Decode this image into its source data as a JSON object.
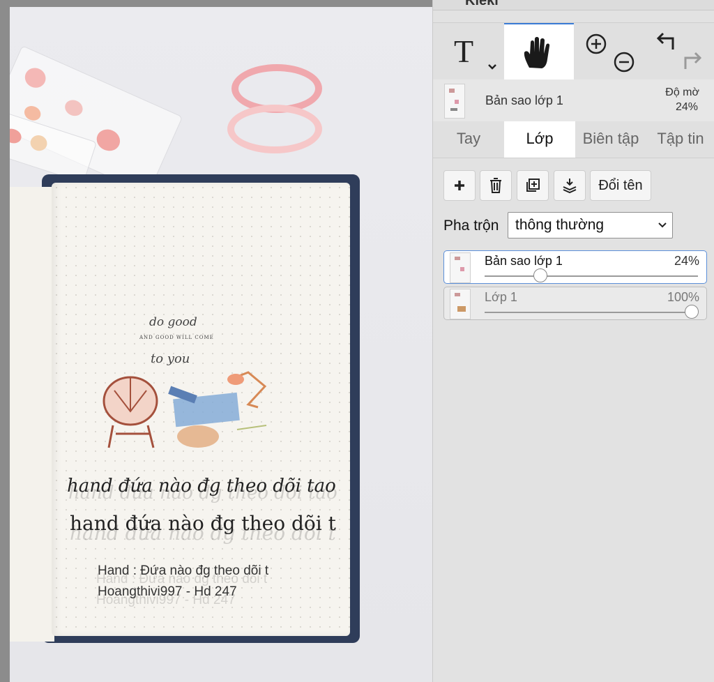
{
  "window": {
    "title_partial": "Kleki"
  },
  "toolbar": {
    "tools": [
      {
        "name": "text",
        "label": "T"
      },
      {
        "name": "hand",
        "active": true
      },
      {
        "name": "zoom"
      },
      {
        "name": "undo-redo"
      }
    ]
  },
  "current_layer": {
    "name": "Bản sao lớp 1",
    "opacity_label": "Độ mờ",
    "opacity_value": "24%"
  },
  "tabs": [
    {
      "label": "Tay",
      "active": false
    },
    {
      "label": "Lớp",
      "active": true
    },
    {
      "label": "Biên tập",
      "active": false
    },
    {
      "label": "Tập tin",
      "active": false
    }
  ],
  "layer_actions": {
    "rename_label": "Đổi tên"
  },
  "blend": {
    "label": "Pha trộn",
    "value": "thông thường"
  },
  "layers": [
    {
      "name": "Bản sao lớp 1",
      "opacity": "24%",
      "opacity_value": 0.24,
      "selected": true
    },
    {
      "name": "Lớp 1",
      "opacity": "100%",
      "opacity_value": 1.0,
      "selected": false
    }
  ],
  "canvas": {
    "small_script": [
      "do good",
      "AND GOOD WILL COME",
      "to you"
    ],
    "hand_line1": "hand đứa nào đg theo dõi tao",
    "hand_line2": "hand đứa nào đg theo dõi t",
    "print_line1": "Hand : Đứa nào đg theo dõi t",
    "print_line2": "Hoangthivi997 - Hd 247"
  },
  "colors": {
    "accent": "#3a7bd5",
    "panel": "#e2e2e2",
    "cover": "#2f3d5a"
  }
}
